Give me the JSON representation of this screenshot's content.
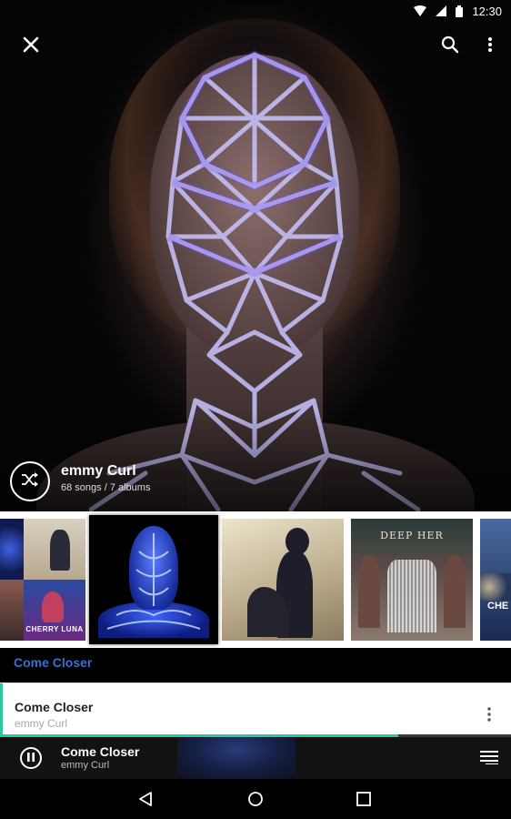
{
  "status": {
    "time": "12:30",
    "icons": [
      "wifi-icon",
      "signal-icon",
      "battery-icon"
    ]
  },
  "header": {
    "close_icon": "close-icon",
    "search_icon": "search-icon",
    "more_icon": "more-vert-icon"
  },
  "artist": {
    "name": "emmy Curl",
    "meta": "68 songs / 7 albums",
    "shuffle_icon": "shuffle-icon"
  },
  "albums": {
    "items": [
      {
        "label": ""
      },
      {
        "label": ""
      },
      {
        "label": ""
      },
      {
        "label": "CHERRY LUNA"
      },
      {
        "label": ""
      },
      {
        "label": ""
      },
      {
        "label": "DEEP HER"
      },
      {
        "label": "CHE"
      }
    ]
  },
  "album_title": "Come Closer",
  "track": {
    "title": "Come Closer",
    "artist": "emmy Curl",
    "more_icon": "more-vert-icon"
  },
  "progress": {
    "fraction": 0.78
  },
  "now_playing": {
    "title": "Come Closer",
    "artist": "emmy Curl",
    "play_icon": "pause-icon",
    "queue_icon": "queue-icon"
  },
  "nav": {
    "back_icon": "back-icon",
    "home_icon": "home-icon",
    "recents_icon": "recents-icon"
  },
  "colors": {
    "accent": "#3b6fd4",
    "progress": "#29c7a0",
    "bar_bg": "#121212"
  }
}
